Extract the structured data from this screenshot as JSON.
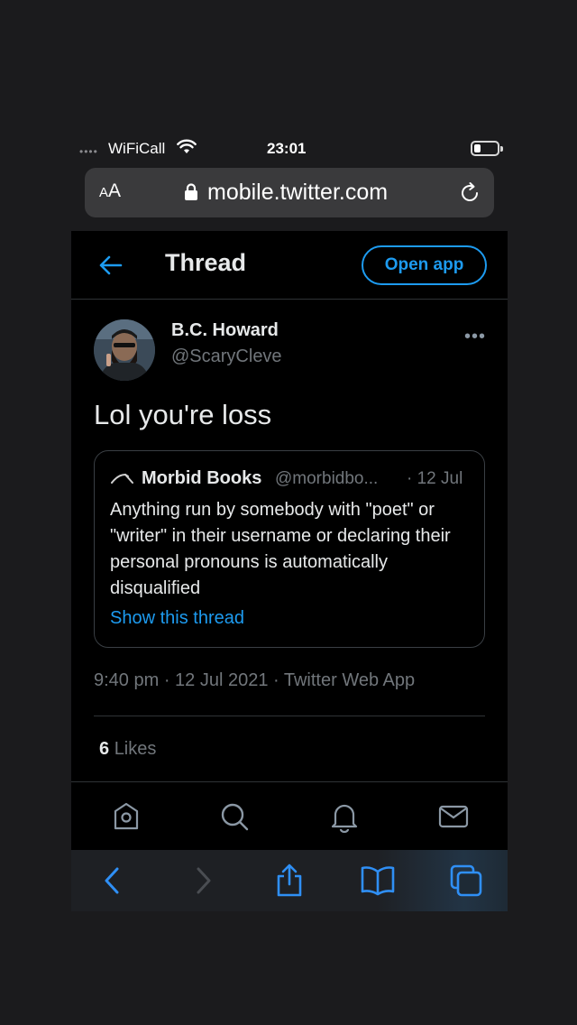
{
  "status_bar": {
    "signal": "••••",
    "carrier": "WiFiCall",
    "time": "23:01",
    "wifi_icon": "wifi-icon",
    "battery_icon": "battery-low-icon"
  },
  "browser": {
    "text_size_label_small": "A",
    "text_size_label_large": "A",
    "url": "mobile.twitter.com",
    "lock_icon": "lock-icon",
    "reload_icon": "reload-icon"
  },
  "header": {
    "back_icon": "back-arrow-icon",
    "title": "Thread",
    "open_app_label": "Open app"
  },
  "tweet": {
    "author_name": "B.C. Howard",
    "author_handle": "@ScaryCleve",
    "more_label": "•••",
    "text": "Lol you're loss",
    "quoted": {
      "author_name": "Morbid Books",
      "author_handle": "@morbidbo...",
      "date": "· 12 Jul",
      "text": "Anything run by somebody with \"poet\" or \"writer\" in their username or declaring their personal pronouns is automatically disqualified",
      "link_label": "Show this thread"
    },
    "meta": "9:40 pm · 12 Jul 2021 · Twitter Web App",
    "likes_count": "6",
    "likes_label": "Likes"
  },
  "twitter_tabs": [
    "home-icon",
    "search-icon",
    "notifications-icon",
    "messages-icon"
  ],
  "safari_toolbar": [
    "back-icon",
    "forward-icon",
    "share-icon",
    "bookmarks-icon",
    "tabs-icon"
  ],
  "colors": {
    "accent": "#1d9bf0",
    "background": "#000000",
    "secondary_text": "#71767b"
  }
}
